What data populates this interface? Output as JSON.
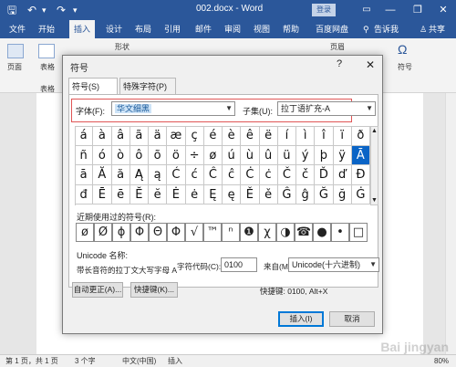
{
  "titlebar": {
    "save_icon": "save-icon",
    "undo_icon": "undo-icon",
    "redo_icon": "redo-icon",
    "title": "002.docx - Word",
    "login": "登录",
    "minimize": "—",
    "restore": "❐",
    "close": "✕"
  },
  "menu": {
    "tabs": [
      "文件",
      "开始",
      "插入",
      "设计",
      "布局",
      "引用",
      "邮件",
      "审阅",
      "视图",
      "帮助",
      "百度网盘"
    ],
    "tell_me": "告诉我",
    "share": "共享",
    "active": "插入"
  },
  "ribbon": {
    "page_group": "页面",
    "table_btn": "表格",
    "table_group": "表格",
    "shape_btn": "形状",
    "page_btn": "页眉",
    "symbol_btn": "符号"
  },
  "dialog": {
    "title": "符号",
    "help": "?",
    "close": "✕",
    "tabs": {
      "symbols": "符号(S)",
      "special": "特殊字符(P)"
    },
    "font_label": "字体(F):",
    "font_value": "华文细黑",
    "subset_label": "子集(U):",
    "subset_value": "拉丁语扩充-A",
    "grid": [
      [
        "á",
        "à",
        "â",
        "ã",
        "ä",
        "æ",
        "ç",
        "é",
        "è",
        "ê",
        "ë",
        "í",
        "ì",
        "î",
        "ï",
        "ð"
      ],
      [
        "ñ",
        "ó",
        "ò",
        "ô",
        "õ",
        "ö",
        "÷",
        "ø",
        "ú",
        "ù",
        "û",
        "ü",
        "ý",
        "þ",
        "ÿ",
        "Ā"
      ],
      [
        "ā",
        "Ă",
        "ă",
        "Ą",
        "ą",
        "Ć",
        "ć",
        "Ĉ",
        "ĉ",
        "Ċ",
        "ċ",
        "Č",
        "č",
        "Ď",
        "ď",
        "Đ"
      ],
      [
        "đ",
        "Ē",
        "ē",
        "Ĕ",
        "ĕ",
        "Ė",
        "ė",
        "Ę",
        "ę",
        "Ě",
        "ě",
        "Ĝ",
        "ĝ",
        "Ğ",
        "ğ",
        "Ġ"
      ]
    ],
    "selected_char": "Ā",
    "recent_label": "近期使用过的符号(R):",
    "recent": [
      "ø",
      "Ø",
      "ϕ",
      "Φ",
      "Θ",
      "Φ",
      "√",
      "™",
      "ⁿ",
      "❶",
      "χ",
      "◑",
      "☎",
      "●",
      "•",
      "□"
    ],
    "unicode_label": "Unicode 名称:",
    "char_desc": "带长音符的拉丁文大写字母 A",
    "code_label": "字符代码(C):",
    "code_value": "0100",
    "from_label": "来自(M):",
    "from_value": "Unicode(十六进制)",
    "autocorrect_btn": "自动更正(A)...",
    "shortcut_btn": "快捷键(K)...",
    "shortcut_text": "快捷键: 0100, Alt+X",
    "insert_btn": "插入(I)",
    "cancel_btn": "取消"
  },
  "statusbar": {
    "page": "第 1 页，共 1 页",
    "words": "3 个字",
    "lang": "中文(中国)",
    "mode": "插入",
    "zoom": "80%"
  },
  "watermark": "Bai jingyan"
}
